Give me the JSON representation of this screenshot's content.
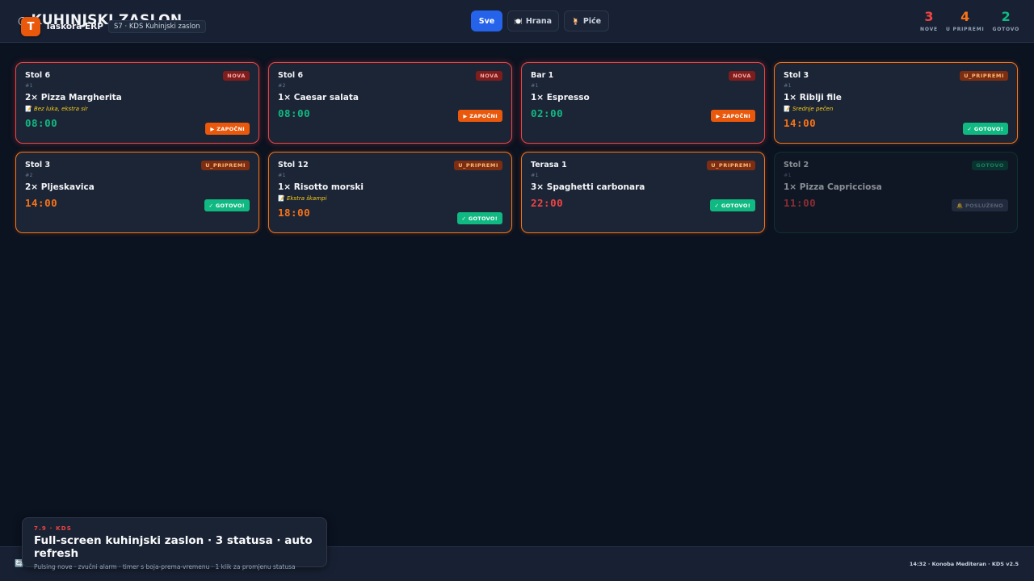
{
  "header": {
    "page_title": "KUHINJSKI ZASLON",
    "logo_letter": "T",
    "brand_name": "Taskora ERP",
    "brand_chip": "S7 · KDS Kuhinjski zaslon",
    "filters": [
      {
        "label": "Sve",
        "icon": ""
      },
      {
        "label": "Hrana",
        "icon": "🍽️"
      },
      {
        "label": "Piće",
        "icon": "🍹"
      }
    ],
    "counts": [
      {
        "value": "3",
        "label": "NOVE",
        "color": "#ef4444"
      },
      {
        "value": "4",
        "label": "U PRIPREMI",
        "color": "#f97316"
      },
      {
        "value": "2",
        "label": "GOTOVO",
        "color": "#10b981"
      }
    ]
  },
  "cards": [
    {
      "table": "Stol 6",
      "seq": "#1",
      "item": "2× Pizza Margherita",
      "note": "Bez luka, ekstra sir",
      "timer": "08:00",
      "status": "NOVA",
      "action": "▶ ZAPOČNI"
    },
    {
      "table": "Stol 6",
      "seq": "#2",
      "item": "1× Caesar salata",
      "note": "",
      "timer": "08:00",
      "status": "NOVA",
      "action": "▶ ZAPOČNI"
    },
    {
      "table": "Bar 1",
      "seq": "#1",
      "item": "1× Espresso",
      "note": "",
      "timer": "02:00",
      "status": "NOVA",
      "action": "▶ ZAPOČNI"
    },
    {
      "table": "Stol 3",
      "seq": "#1",
      "item": "1× Riblji file",
      "note": "Srednje pečen",
      "timer": "14:00",
      "status": "U_PRIPREMI",
      "action": "✓ GOTOVO!"
    },
    {
      "table": "Stol 3",
      "seq": "#2",
      "item": "2× Pljeskavica",
      "note": "",
      "timer": "14:00",
      "status": "U_PRIPREMI",
      "action": "✓ GOTOVO!"
    },
    {
      "table": "Stol 12",
      "seq": "#1",
      "item": "1× Risotto morski",
      "note": "Ekstra škampi",
      "timer": "18:00",
      "status": "U_PRIPREMI",
      "action": "✓ GOTOVO!"
    },
    {
      "table": "Terasa 1",
      "seq": "#1",
      "item": "3× Spaghetti carbonara",
      "note": "",
      "timer": "22:00",
      "status": "U_PRIPREMI",
      "action": "✓ GOTOVO!"
    },
    {
      "table": "Stol 2",
      "seq": "#1",
      "item": "1× Pizza Capricciosa",
      "note": "",
      "timer": "11:00",
      "status": "GOTOVO",
      "action": "🔔 POSLUŽENO"
    }
  ],
  "footer": {
    "refresh_icon": "🔄",
    "right_text": "14:32 · Konoba Mediteran · KDS v2.5"
  },
  "overlay": {
    "tag": "7.9 · KDS",
    "title": "Full-screen kuhinjski zaslon · 3 statusa · auto refresh",
    "subtitle": "Pulsing nove · zvučni alarm · timer s boja-prema-vremenu · 1 klik za promjenu statusa"
  },
  "colors": {
    "nova": "#ef4444",
    "prep": "#f97316",
    "done": "#10b981",
    "accent": "#2563eb"
  }
}
